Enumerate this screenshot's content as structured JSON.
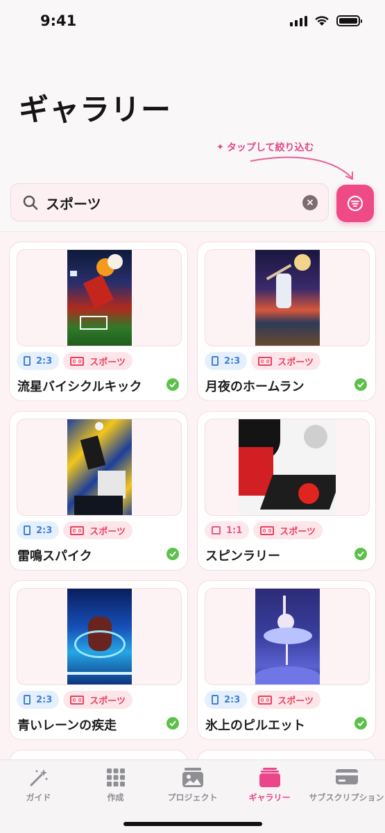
{
  "status_bar": {
    "time": "9:41"
  },
  "page": {
    "title": "ギャラリー"
  },
  "hint": {
    "text": "タップして絞り込む"
  },
  "search": {
    "value": "スポーツ",
    "clear_label": "×"
  },
  "colors": {
    "accent": "#ee4a86",
    "check": "#5cc14b",
    "ratio_blue": "#3c7fd8",
    "category_red": "#ea3f5e"
  },
  "gallery": {
    "items": [
      {
        "title": "流星バイシクルキック",
        "ratio": "2:3",
        "category": "スポーツ",
        "status": "check-icon"
      },
      {
        "title": "月夜のホームラン",
        "ratio": "2:3",
        "category": "スポーツ",
        "status": "check-icon"
      },
      {
        "title": "雷鳴スパイク",
        "ratio": "2:3",
        "category": "スポーツ",
        "status": "check-icon"
      },
      {
        "title": "スピンラリー",
        "ratio": "1:1",
        "category": "スポーツ",
        "status": "check-icon"
      },
      {
        "title": "青いレーンの疾走",
        "ratio": "2:3",
        "category": "スポーツ",
        "status": "check-icon"
      },
      {
        "title": "氷上のピルエット",
        "ratio": "2:3",
        "category": "スポーツ",
        "status": "check-icon"
      }
    ]
  },
  "tab_bar": {
    "tabs": [
      {
        "label": "ガイド",
        "icon": "magic-wand-icon"
      },
      {
        "label": "作成",
        "icon": "grid-icon"
      },
      {
        "label": "プロジェクト",
        "icon": "photo-stack-icon"
      },
      {
        "label": "ギャラリー",
        "icon": "gallery-stack-icon",
        "active": true
      },
      {
        "label": "サブスクリプション",
        "icon": "credit-card-icon"
      }
    ]
  }
}
